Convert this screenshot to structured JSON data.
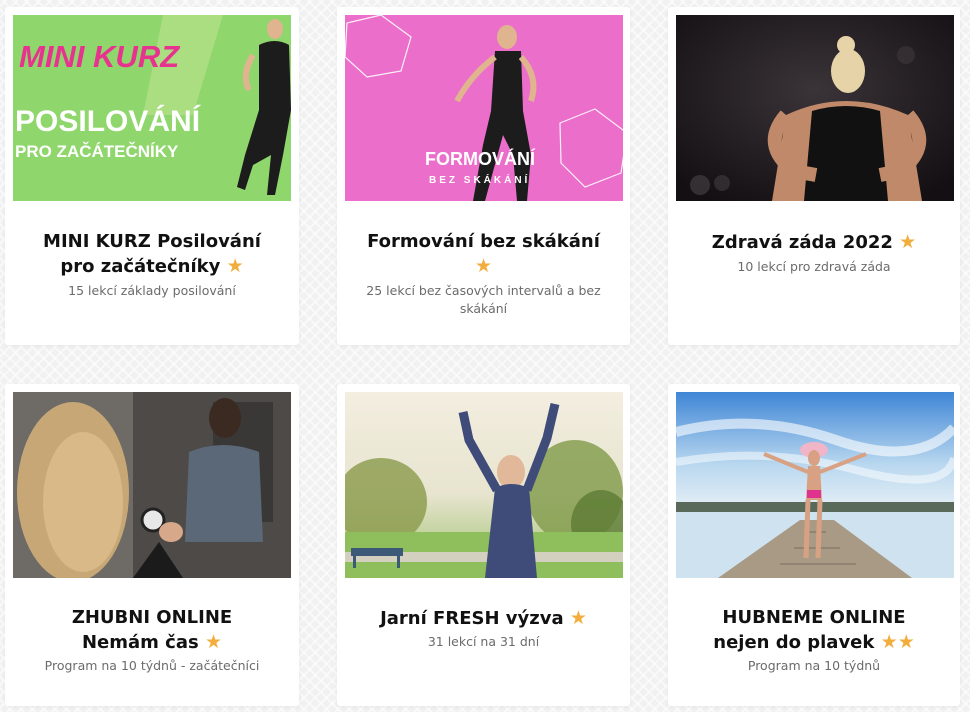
{
  "accent_star_color": "#f2ae3c",
  "star_glyph": "★",
  "cards": [
    {
      "thumb_text": {
        "line1": "MINI KURZ",
        "line2": "POSILOVÁNÍ",
        "line3": "PRO ZAČÁTEČNÍKY"
      },
      "title_line1": "MINI KURZ Posilování",
      "title_line2": "pro začátečníky",
      "stars": 1,
      "subtitle": "15 lekcí základy posilování"
    },
    {
      "thumb_text": {
        "line1": "FORMOVÁNÍ",
        "line2": "BEZ SKÁKÁNÍ"
      },
      "title_line1": "Formování bez skákání",
      "stars": 1,
      "subtitle": "25 lekcí bez časových intervalů a bez skákání"
    },
    {
      "title_line1": "Zdravá záda 2022",
      "stars": 1,
      "subtitle": "10 lekcí pro zdravá záda"
    },
    {
      "title_line1": "ZHUBNI ONLINE",
      "title_line2": "Nemám čas",
      "stars": 1,
      "subtitle": "Program na 10 týdnů - začátečníci"
    },
    {
      "title_line1": "Jarní FRESH výzva",
      "stars": 1,
      "subtitle": "31 lekcí na 31 dní"
    },
    {
      "title_line1": "HUBNEME ONLINE",
      "title_line2": "nejen do plavek",
      "stars": 2,
      "subtitle": "Program na 10 týdnů"
    }
  ]
}
